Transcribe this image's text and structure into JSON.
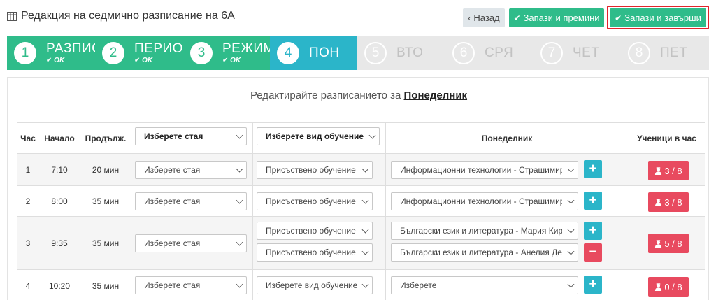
{
  "header": {
    "title": "Редакция на седмично разписание на 6А",
    "back_label": "Назад",
    "save_next_label": "Запази и премини",
    "save_finish_label": "Запази и завърши"
  },
  "steps": [
    {
      "number": "1",
      "name": "РАЗПИС",
      "status": "OK",
      "state": "done"
    },
    {
      "number": "2",
      "name": "ПЕРИО,",
      "status": "OK",
      "state": "done"
    },
    {
      "number": "3",
      "name": "РЕЖИМ",
      "status": "OK",
      "state": "done"
    },
    {
      "number": "4",
      "name": "ПОН",
      "status": "",
      "state": "active"
    },
    {
      "number": "5",
      "name": "ВТО",
      "status": "",
      "state": "pending"
    },
    {
      "number": "6",
      "name": "СРЯ",
      "status": "",
      "state": "pending"
    },
    {
      "number": "7",
      "name": "ЧЕТ",
      "status": "",
      "state": "pending"
    },
    {
      "number": "8",
      "name": "ПЕТ",
      "status": "",
      "state": "pending"
    }
  ],
  "instruction": {
    "prefix": "Редактирайте разписанието за ",
    "day": "Понеделник"
  },
  "table": {
    "headers": {
      "hour": "Час",
      "start": "Начало",
      "duration": "Продълж.",
      "room_select": "Изберете стая",
      "training_select": "Изберете вид обучение",
      "day": "Понеделник",
      "students": "Ученици в час"
    },
    "rows": [
      {
        "hour": "1",
        "start": "7:10",
        "duration": "20 мин",
        "room": "Изберете стая",
        "entries": [
          {
            "training": "Присъствено обучение",
            "subject": "Информационни технологии - Страшимир",
            "action": "+"
          }
        ],
        "students": "3 / 8"
      },
      {
        "hour": "2",
        "start": "8:00",
        "duration": "35 мин",
        "room": "Изберете стая",
        "entries": [
          {
            "training": "Присъствено обучение",
            "subject": "Информационни технологии - Страшимир",
            "action": "+"
          }
        ],
        "students": "3 / 8"
      },
      {
        "hour": "3",
        "start": "9:35",
        "duration": "35 мин",
        "room": "Изберете стая",
        "entries": [
          {
            "training": "Присъствено обучение",
            "subject": "Български език и литература - Мария Кирч",
            "action": "+"
          },
          {
            "training": "Присъствено обучение",
            "subject": "Български език и литература - Анелия Дем",
            "action": "−"
          }
        ],
        "students": "5 / 8"
      },
      {
        "hour": "4",
        "start": "10:20",
        "duration": "35 мин",
        "room": "Изберете стая",
        "entries": [
          {
            "training": "Изберете вид обучение",
            "subject": "Изберете",
            "action": "+"
          }
        ],
        "students": "0 / 8"
      }
    ]
  },
  "colors": {
    "green": "#2fbc8a",
    "cyan": "#2bb5c9",
    "red": "#e84a5f",
    "gray_step": "#e8e8e8",
    "highlight_border": "#e0242b"
  },
  "icons": {
    "title": "table-icon",
    "back": "chevron-left-icon",
    "check": "check-icon",
    "students": "user-graduate-icon"
  }
}
